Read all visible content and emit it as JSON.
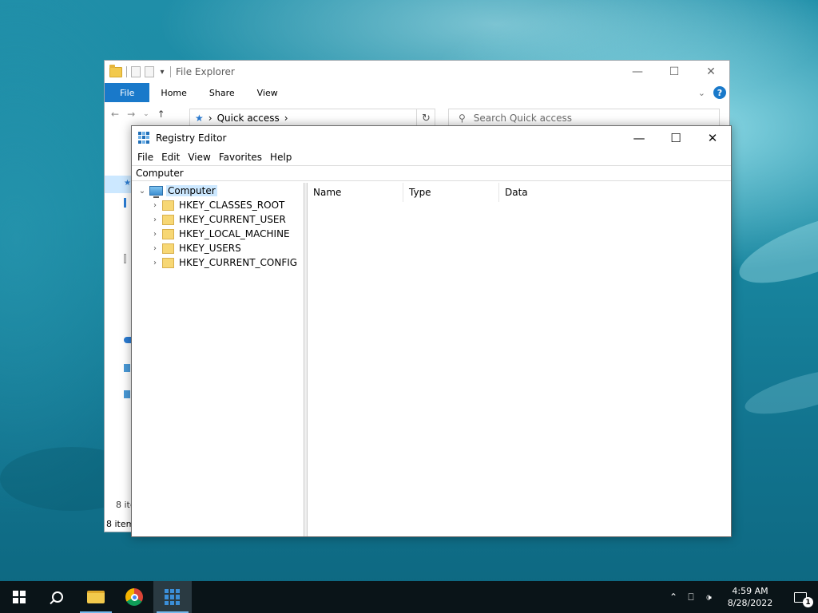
{
  "file_explorer": {
    "title": "File Explorer",
    "tabs": [
      "File",
      "Home",
      "Share",
      "View"
    ],
    "address": "Quick access",
    "search_placeholder": "Search Quick access",
    "status_items": "8 ite",
    "status_items_bottom": "8 item"
  },
  "registry_editor": {
    "title": "Registry Editor",
    "menu": [
      "File",
      "Edit",
      "View",
      "Favorites",
      "Help"
    ],
    "address": "Computer",
    "tree": {
      "root": "Computer",
      "children": [
        "HKEY_CLASSES_ROOT",
        "HKEY_CURRENT_USER",
        "HKEY_LOCAL_MACHINE",
        "HKEY_USERS",
        "HKEY_CURRENT_CONFIG"
      ]
    },
    "columns": [
      "Name",
      "Type",
      "Data"
    ]
  },
  "taskbar": {
    "apps": [
      "start",
      "search",
      "file-explorer",
      "chrome",
      "registry-editor"
    ],
    "clock_time": "4:59 AM",
    "clock_date": "8/28/2022",
    "notification_count": "1"
  }
}
